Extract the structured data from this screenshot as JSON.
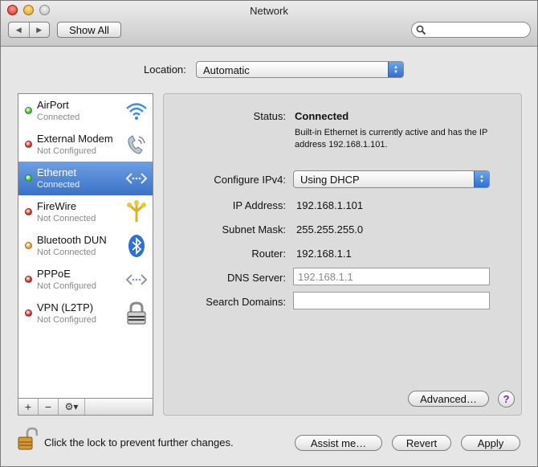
{
  "window": {
    "title": "Network"
  },
  "toolbar": {
    "back": "◀",
    "forward": "▶",
    "show_all": "Show All",
    "search_placeholder": ""
  },
  "location": {
    "label": "Location:",
    "value": "Automatic"
  },
  "services": [
    {
      "name": "AirPort",
      "status": "Connected",
      "status_color": "#3fbf2f",
      "icon": "wifi-icon"
    },
    {
      "name": "External Modem",
      "status": "Not Configured",
      "status_color": "#d82a1e",
      "icon": "phone-icon"
    },
    {
      "name": "Ethernet",
      "status": "Connected",
      "status_color": "#3fbf2f",
      "icon": "ethernet-icon",
      "selected": true
    },
    {
      "name": "FireWire",
      "status": "Not Connected",
      "status_color": "#d82a1e",
      "icon": "firewire-icon"
    },
    {
      "name": "Bluetooth DUN",
      "status": "Not Connected",
      "status_color": "#e8a21c",
      "icon": "bluetooth-icon"
    },
    {
      "name": "PPPoE",
      "status": "Not Configured",
      "status_color": "#d82a1e",
      "icon": "pppoe-icon"
    },
    {
      "name": "VPN (L2TP)",
      "status": "Not Configured",
      "status_color": "#d82a1e",
      "icon": "lock-icon"
    }
  ],
  "sidebar_buttons": {
    "add": "+",
    "remove": "−",
    "action": "⚙▾"
  },
  "details": {
    "status_label": "Status:",
    "status_value": "Connected",
    "status_description": "Built-in Ethernet is currently active and has the IP address 192.168.1.101.",
    "configure_label": "Configure IPv4:",
    "configure_value": "Using DHCP",
    "ip_label": "IP Address:",
    "ip_value": "192.168.1.101",
    "subnet_label": "Subnet Mask:",
    "subnet_value": "255.255.255.0",
    "router_label": "Router:",
    "router_value": "192.168.1.1",
    "dns_label": "DNS Server:",
    "dns_placeholder": "192.168.1.1",
    "search_domains_label": "Search Domains:",
    "search_domains_value": ""
  },
  "buttons": {
    "advanced": "Advanced…",
    "help": "?",
    "assist": "Assist me…",
    "revert": "Revert",
    "apply": "Apply"
  },
  "lock": {
    "text": "Click the lock to prevent further changes."
  },
  "colors": {
    "selection": "#3b72c7",
    "popup_arrow": "#2c6fd7"
  }
}
